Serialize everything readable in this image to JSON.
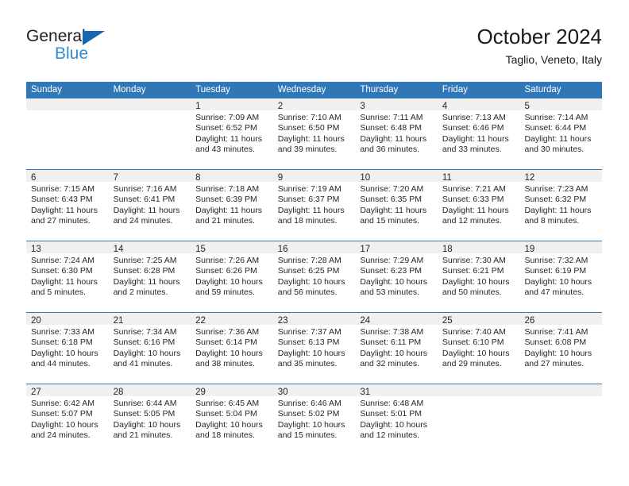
{
  "brand": {
    "name_top": "General",
    "name_bottom": "Blue"
  },
  "header": {
    "month_title": "October 2024",
    "location": "Taglio, Veneto, Italy"
  },
  "colors": {
    "header_blue": "#3077b8",
    "logo_blue": "#2e8bd4",
    "logo_triangle": "#1567b0",
    "daynum_strip": "#f0f0f0",
    "text": "#262626"
  },
  "calendar": {
    "weekday_headers": [
      "Sunday",
      "Monday",
      "Tuesday",
      "Wednesday",
      "Thursday",
      "Friday",
      "Saturday"
    ],
    "weeks": [
      [
        {
          "day": ""
        },
        {
          "day": ""
        },
        {
          "day": "1",
          "sunrise": "Sunrise: 7:09 AM",
          "sunset": "Sunset: 6:52 PM",
          "daylight_1": "Daylight: 11 hours",
          "daylight_2": "and 43 minutes."
        },
        {
          "day": "2",
          "sunrise": "Sunrise: 7:10 AM",
          "sunset": "Sunset: 6:50 PM",
          "daylight_1": "Daylight: 11 hours",
          "daylight_2": "and 39 minutes."
        },
        {
          "day": "3",
          "sunrise": "Sunrise: 7:11 AM",
          "sunset": "Sunset: 6:48 PM",
          "daylight_1": "Daylight: 11 hours",
          "daylight_2": "and 36 minutes."
        },
        {
          "day": "4",
          "sunrise": "Sunrise: 7:13 AM",
          "sunset": "Sunset: 6:46 PM",
          "daylight_1": "Daylight: 11 hours",
          "daylight_2": "and 33 minutes."
        },
        {
          "day": "5",
          "sunrise": "Sunrise: 7:14 AM",
          "sunset": "Sunset: 6:44 PM",
          "daylight_1": "Daylight: 11 hours",
          "daylight_2": "and 30 minutes."
        }
      ],
      [
        {
          "day": "6",
          "sunrise": "Sunrise: 7:15 AM",
          "sunset": "Sunset: 6:43 PM",
          "daylight_1": "Daylight: 11 hours",
          "daylight_2": "and 27 minutes."
        },
        {
          "day": "7",
          "sunrise": "Sunrise: 7:16 AM",
          "sunset": "Sunset: 6:41 PM",
          "daylight_1": "Daylight: 11 hours",
          "daylight_2": "and 24 minutes."
        },
        {
          "day": "8",
          "sunrise": "Sunrise: 7:18 AM",
          "sunset": "Sunset: 6:39 PM",
          "daylight_1": "Daylight: 11 hours",
          "daylight_2": "and 21 minutes."
        },
        {
          "day": "9",
          "sunrise": "Sunrise: 7:19 AM",
          "sunset": "Sunset: 6:37 PM",
          "daylight_1": "Daylight: 11 hours",
          "daylight_2": "and 18 minutes."
        },
        {
          "day": "10",
          "sunrise": "Sunrise: 7:20 AM",
          "sunset": "Sunset: 6:35 PM",
          "daylight_1": "Daylight: 11 hours",
          "daylight_2": "and 15 minutes."
        },
        {
          "day": "11",
          "sunrise": "Sunrise: 7:21 AM",
          "sunset": "Sunset: 6:33 PM",
          "daylight_1": "Daylight: 11 hours",
          "daylight_2": "and 12 minutes."
        },
        {
          "day": "12",
          "sunrise": "Sunrise: 7:23 AM",
          "sunset": "Sunset: 6:32 PM",
          "daylight_1": "Daylight: 11 hours",
          "daylight_2": "and 8 minutes."
        }
      ],
      [
        {
          "day": "13",
          "sunrise": "Sunrise: 7:24 AM",
          "sunset": "Sunset: 6:30 PM",
          "daylight_1": "Daylight: 11 hours",
          "daylight_2": "and 5 minutes."
        },
        {
          "day": "14",
          "sunrise": "Sunrise: 7:25 AM",
          "sunset": "Sunset: 6:28 PM",
          "daylight_1": "Daylight: 11 hours",
          "daylight_2": "and 2 minutes."
        },
        {
          "day": "15",
          "sunrise": "Sunrise: 7:26 AM",
          "sunset": "Sunset: 6:26 PM",
          "daylight_1": "Daylight: 10 hours",
          "daylight_2": "and 59 minutes."
        },
        {
          "day": "16",
          "sunrise": "Sunrise: 7:28 AM",
          "sunset": "Sunset: 6:25 PM",
          "daylight_1": "Daylight: 10 hours",
          "daylight_2": "and 56 minutes."
        },
        {
          "day": "17",
          "sunrise": "Sunrise: 7:29 AM",
          "sunset": "Sunset: 6:23 PM",
          "daylight_1": "Daylight: 10 hours",
          "daylight_2": "and 53 minutes."
        },
        {
          "day": "18",
          "sunrise": "Sunrise: 7:30 AM",
          "sunset": "Sunset: 6:21 PM",
          "daylight_1": "Daylight: 10 hours",
          "daylight_2": "and 50 minutes."
        },
        {
          "day": "19",
          "sunrise": "Sunrise: 7:32 AM",
          "sunset": "Sunset: 6:19 PM",
          "daylight_1": "Daylight: 10 hours",
          "daylight_2": "and 47 minutes."
        }
      ],
      [
        {
          "day": "20",
          "sunrise": "Sunrise: 7:33 AM",
          "sunset": "Sunset: 6:18 PM",
          "daylight_1": "Daylight: 10 hours",
          "daylight_2": "and 44 minutes."
        },
        {
          "day": "21",
          "sunrise": "Sunrise: 7:34 AM",
          "sunset": "Sunset: 6:16 PM",
          "daylight_1": "Daylight: 10 hours",
          "daylight_2": "and 41 minutes."
        },
        {
          "day": "22",
          "sunrise": "Sunrise: 7:36 AM",
          "sunset": "Sunset: 6:14 PM",
          "daylight_1": "Daylight: 10 hours",
          "daylight_2": "and 38 minutes."
        },
        {
          "day": "23",
          "sunrise": "Sunrise: 7:37 AM",
          "sunset": "Sunset: 6:13 PM",
          "daylight_1": "Daylight: 10 hours",
          "daylight_2": "and 35 minutes."
        },
        {
          "day": "24",
          "sunrise": "Sunrise: 7:38 AM",
          "sunset": "Sunset: 6:11 PM",
          "daylight_1": "Daylight: 10 hours",
          "daylight_2": "and 32 minutes."
        },
        {
          "day": "25",
          "sunrise": "Sunrise: 7:40 AM",
          "sunset": "Sunset: 6:10 PM",
          "daylight_1": "Daylight: 10 hours",
          "daylight_2": "and 29 minutes."
        },
        {
          "day": "26",
          "sunrise": "Sunrise: 7:41 AM",
          "sunset": "Sunset: 6:08 PM",
          "daylight_1": "Daylight: 10 hours",
          "daylight_2": "and 27 minutes."
        }
      ],
      [
        {
          "day": "27",
          "sunrise": "Sunrise: 6:42 AM",
          "sunset": "Sunset: 5:07 PM",
          "daylight_1": "Daylight: 10 hours",
          "daylight_2": "and 24 minutes."
        },
        {
          "day": "28",
          "sunrise": "Sunrise: 6:44 AM",
          "sunset": "Sunset: 5:05 PM",
          "daylight_1": "Daylight: 10 hours",
          "daylight_2": "and 21 minutes."
        },
        {
          "day": "29",
          "sunrise": "Sunrise: 6:45 AM",
          "sunset": "Sunset: 5:04 PM",
          "daylight_1": "Daylight: 10 hours",
          "daylight_2": "and 18 minutes."
        },
        {
          "day": "30",
          "sunrise": "Sunrise: 6:46 AM",
          "sunset": "Sunset: 5:02 PM",
          "daylight_1": "Daylight: 10 hours",
          "daylight_2": "and 15 minutes."
        },
        {
          "day": "31",
          "sunrise": "Sunrise: 6:48 AM",
          "sunset": "Sunset: 5:01 PM",
          "daylight_1": "Daylight: 10 hours",
          "daylight_2": "and 12 minutes."
        },
        {
          "day": ""
        },
        {
          "day": ""
        }
      ]
    ]
  }
}
